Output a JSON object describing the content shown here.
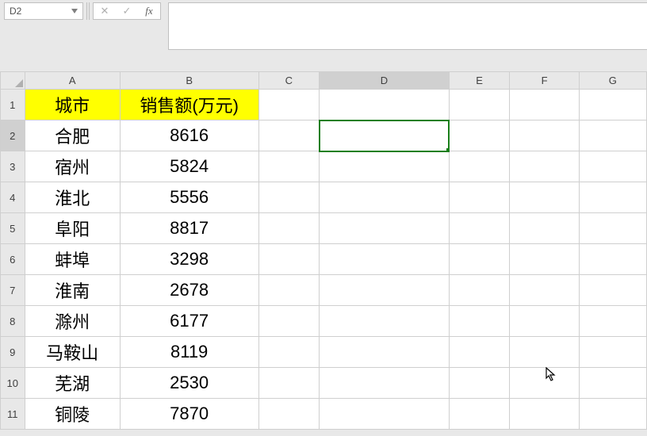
{
  "namebox": {
    "value": "D2"
  },
  "fx_icons": {
    "cancel": "✕",
    "confirm": "✓",
    "fx": "fx"
  },
  "columns": [
    "A",
    "B",
    "C",
    "D",
    "E",
    "F",
    "G"
  ],
  "row_numbers": [
    "1",
    "2",
    "3",
    "4",
    "5",
    "6",
    "7",
    "8",
    "9",
    "10",
    "11"
  ],
  "chart_data": {
    "type": "table",
    "headers": [
      "城市",
      "销售额(万元)"
    ],
    "rows": [
      {
        "city": "合肥",
        "sales": "8616"
      },
      {
        "city": "宿州",
        "sales": "5824"
      },
      {
        "city": "淮北",
        "sales": "5556"
      },
      {
        "city": "阜阳",
        "sales": "8817"
      },
      {
        "city": "蚌埠",
        "sales": "3298"
      },
      {
        "city": "淮南",
        "sales": "2678"
      },
      {
        "city": "滁州",
        "sales": "6177"
      },
      {
        "city": "马鞍山",
        "sales": "8119"
      },
      {
        "city": "芜湖",
        "sales": "2530"
      },
      {
        "city": "铜陵",
        "sales": "7870"
      }
    ]
  },
  "selected_cell": "D2"
}
